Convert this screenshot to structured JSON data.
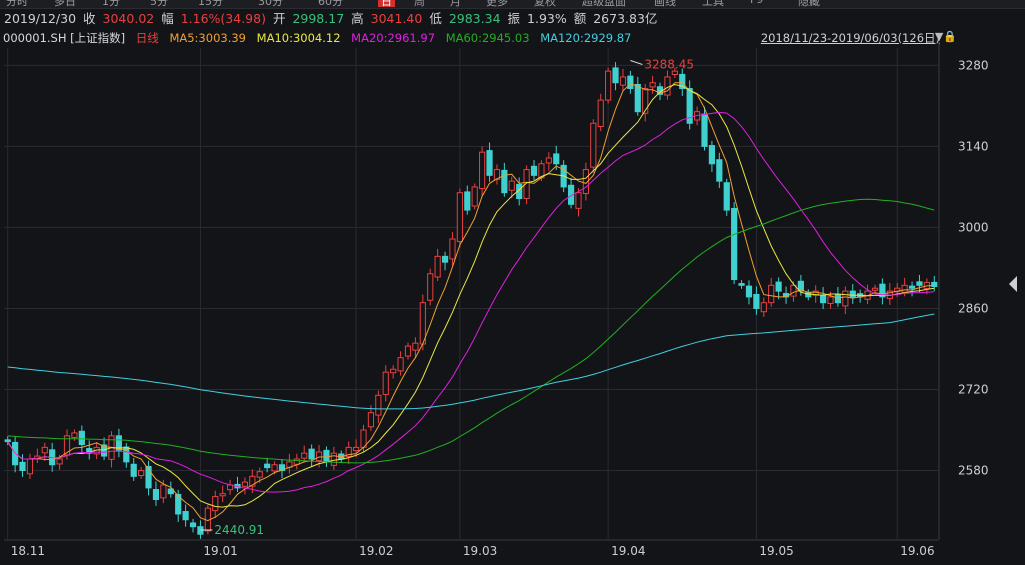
{
  "tabs": [
    "分时",
    "多日",
    "1分",
    "5分",
    "15分",
    "30分",
    "60分",
    "日",
    "周",
    "月",
    "更多",
    "复权",
    "超级盘面",
    "画线",
    "工具",
    "F9",
    "隐藏"
  ],
  "quote": {
    "date": "2019/12/30",
    "close_label": "收",
    "close": "3040.02",
    "chg_label": "幅",
    "chg": "1.16%(34.98)",
    "open_label": "开",
    "open": "2998.17",
    "high_label": "高",
    "high": "3041.40",
    "low_label": "低",
    "low": "2983.34",
    "amp_label": "振",
    "amp": "1.93%",
    "amount_label": "额",
    "amount": "2673.83亿"
  },
  "indicator": {
    "code": "000001.SH [上证指数]",
    "period": "日线",
    "ma5": "MA5:3003.39",
    "ma10": "MA10:3004.12",
    "ma20": "MA20:2961.97",
    "ma60": "MA60:2945.03",
    "ma120": "MA120:2929.87",
    "range": "2018/11/23-2019/06/03(126日)"
  },
  "colors": {
    "up": "#e84040",
    "down": "#3fd1d0",
    "ma5": "#f0a030",
    "ma10": "#e8e840",
    "ma20": "#e020e0",
    "ma60": "#20b020",
    "ma120": "#40d0e0",
    "grid": "#2a2b30"
  },
  "chart_data": {
    "type": "candlestick",
    "ylim": [
      2460,
      3310
    ],
    "y_ticks": [
      2580,
      2720,
      2860,
      3000,
      3140,
      3280
    ],
    "x_ticks": [
      {
        "label": "18.11",
        "index": 0
      },
      {
        "label": "19.01",
        "index": 26
      },
      {
        "label": "19.02",
        "index": 47
      },
      {
        "label": "19.03",
        "index": 61
      },
      {
        "label": "19.04",
        "index": 81
      },
      {
        "label": "19.05",
        "index": 101
      },
      {
        "label": "19.06",
        "index": 120
      }
    ],
    "annotations": [
      {
        "text": "3288.45",
        "index": 84,
        "value": 3288.45,
        "kind": "high"
      },
      {
        "text": "2440.91",
        "index": 26,
        "value": 2440.91,
        "kind": "low"
      }
    ],
    "closes": [
      2630,
      2590,
      2580,
      2600,
      2605,
      2620,
      2590,
      2600,
      2640,
      2645,
      2625,
      2610,
      2620,
      2605,
      2640,
      2615,
      2595,
      2570,
      2580,
      2550,
      2530,
      2555,
      2540,
      2505,
      2495,
      2483,
      2470,
      2515,
      2535,
      2540,
      2555,
      2550,
      2560,
      2570,
      2578,
      2585,
      2590,
      2580,
      2595,
      2600,
      2610,
      2600,
      2612,
      2596,
      2610,
      2600,
      2620,
      2620,
      2650,
      2680,
      2710,
      2750,
      2755,
      2775,
      2795,
      2800,
      2870,
      2920,
      2950,
      2940,
      2980,
      3060,
      3030,
      3070,
      3130,
      3090,
      3100,
      3060,
      3080,
      3050,
      3100,
      3090,
      3110,
      3120,
      3110,
      3070,
      3040,
      3060,
      3100,
      3180,
      3220,
      3270,
      3250,
      3260,
      3240,
      3200,
      3240,
      3250,
      3230,
      3260,
      3270,
      3240,
      3180,
      3200,
      3140,
      3110,
      3080,
      3030,
      2910,
      2900,
      2880,
      2860,
      2870,
      2900,
      2890,
      2880,
      2900,
      2890,
      2880,
      2890,
      2870,
      2880,
      2870,
      2890,
      2880,
      2880,
      2890,
      2895,
      2880,
      2890,
      2895,
      2900,
      2895,
      2900,
      2905,
      2898
    ]
  }
}
